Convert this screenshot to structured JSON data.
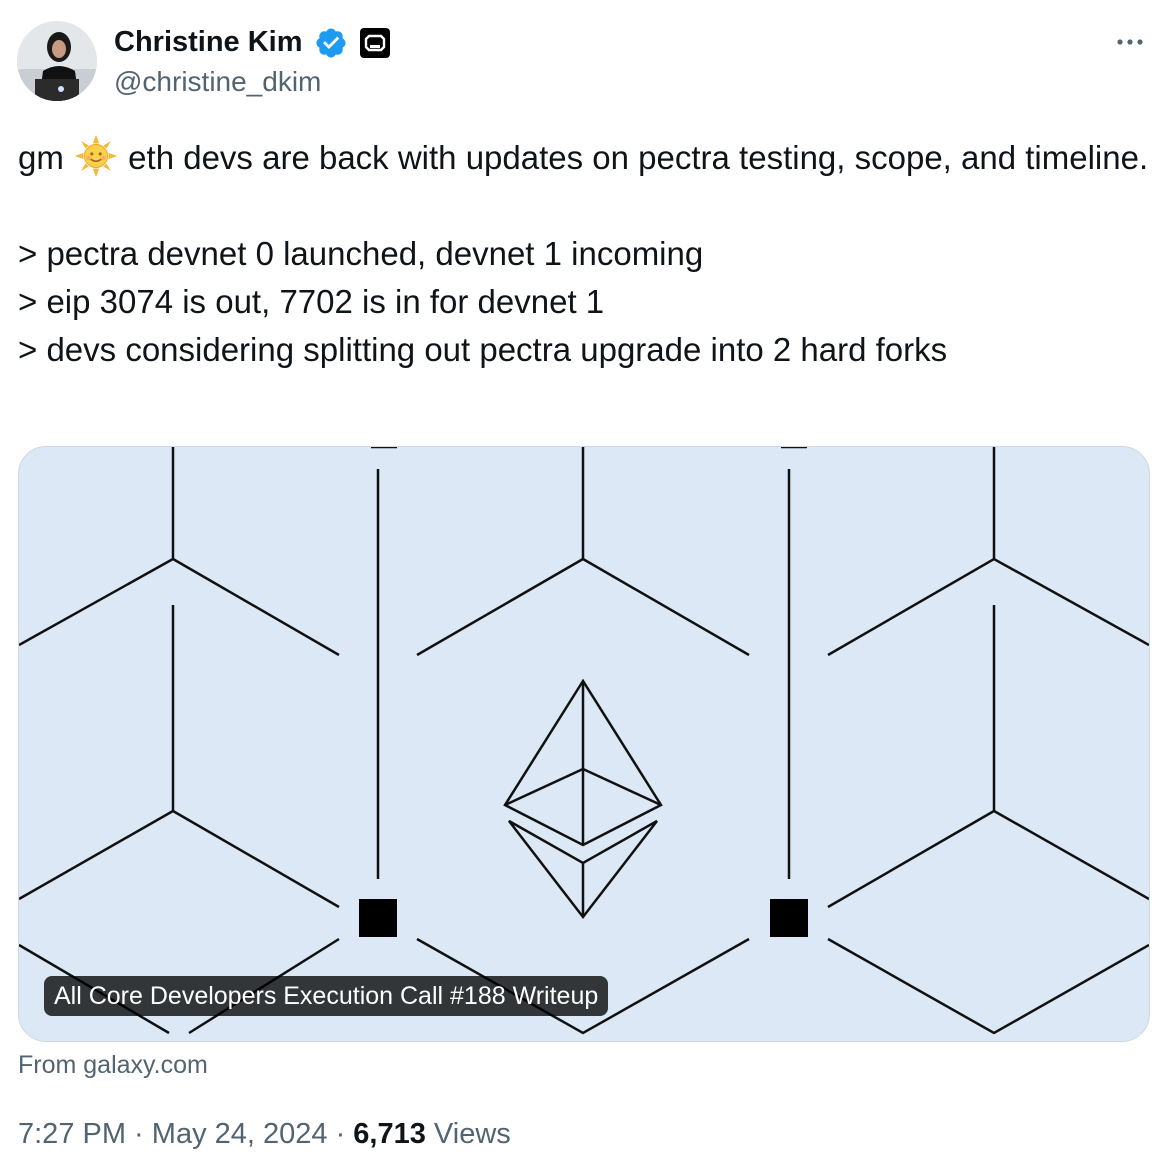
{
  "author": {
    "name": "Christine Kim",
    "handle": "@christine_dkim",
    "verified": true
  },
  "tweet": {
    "text_before_emoji": "gm ",
    "emoji": "sun-with-face",
    "text_after_emoji": " eth devs are back with updates on pectra testing, scope, and timeline.\n\n> pectra devnet 0 launched, devnet 1 incoming\n> eip 3074 is out, 7702 is in for devnet 1\n> devs considering splitting out pectra upgrade into 2 hard forks"
  },
  "card": {
    "title": "All Core Developers Execution Call #188 Writeup",
    "source": "From galaxy.com",
    "image_icon": "ethereum-logo",
    "background_color": "#dce8f5"
  },
  "meta": {
    "time": "7:27 PM",
    "separator": " · ",
    "date": "May 24, 2024",
    "views_count": "6,713",
    "views_label": " Views"
  },
  "colors": {
    "text": "#0f1419",
    "secondary": "#536471",
    "verified": "#1d9bf0",
    "border": "#cfd9de"
  }
}
